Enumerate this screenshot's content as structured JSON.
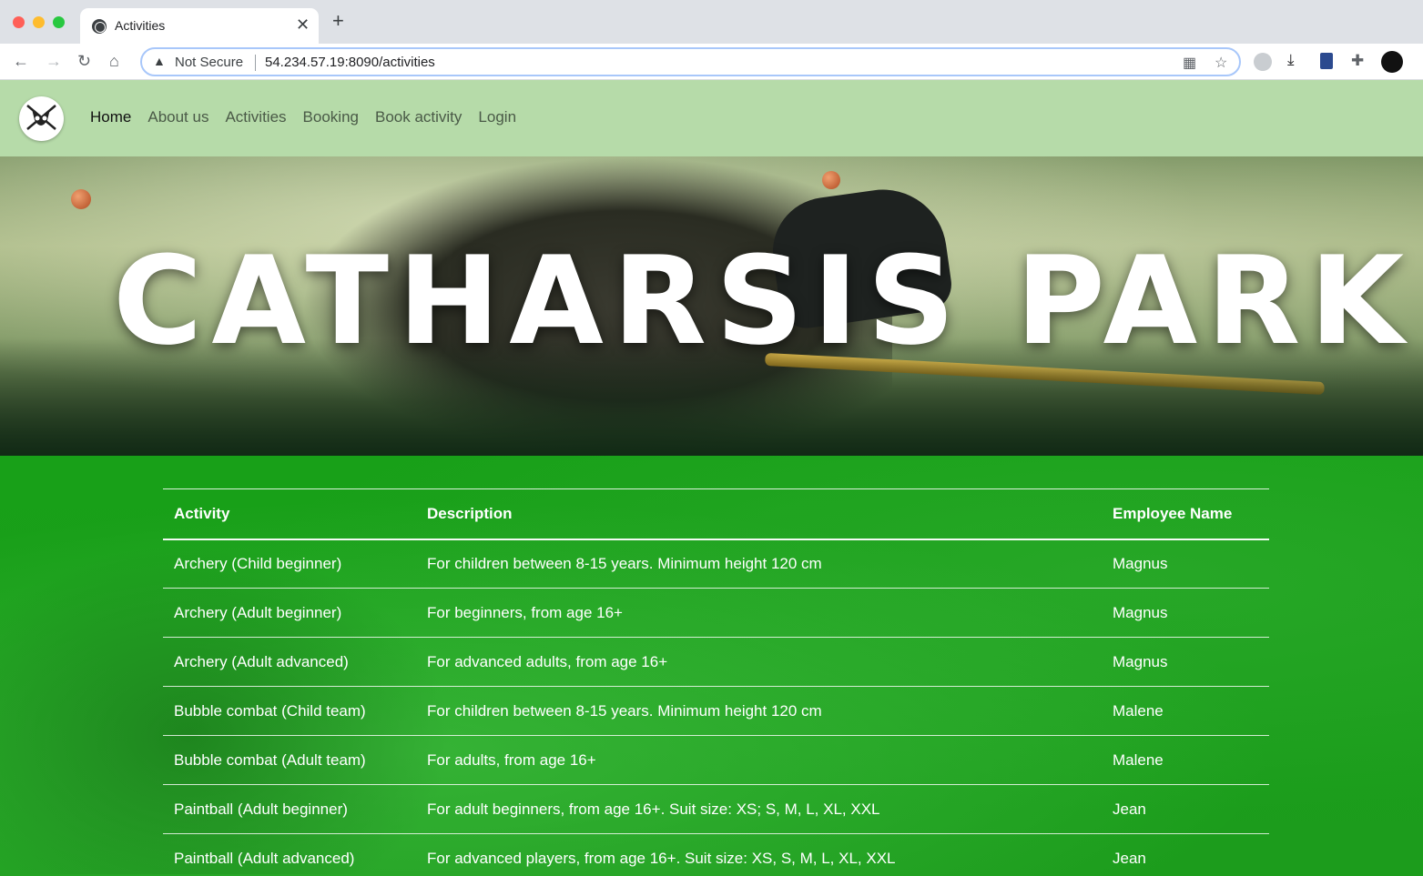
{
  "browser": {
    "tab_title": "Activities",
    "not_secure_label": "Not Secure",
    "url": "54.234.57.19:8090/activities"
  },
  "site": {
    "nav": [
      {
        "label": "Home",
        "active": true
      },
      {
        "label": "About us",
        "active": false
      },
      {
        "label": "Activities",
        "active": false
      },
      {
        "label": "Booking",
        "active": false
      },
      {
        "label": "Book activity",
        "active": false
      },
      {
        "label": "Login",
        "active": false
      }
    ],
    "hero_title": "CATHARSIS PARK"
  },
  "table": {
    "headers": [
      "Activity",
      "Description",
      "Employee Name"
    ],
    "rows": [
      {
        "activity": "Archery (Child beginner)",
        "description": "For children between 8-15 years. Minimum height 120 cm",
        "employee": "Magnus"
      },
      {
        "activity": "Archery (Adult beginner)",
        "description": "For beginners, from age 16+",
        "employee": "Magnus"
      },
      {
        "activity": "Archery (Adult advanced)",
        "description": "For advanced adults, from age 16+",
        "employee": "Magnus"
      },
      {
        "activity": "Bubble combat (Child team)",
        "description": "For children between 8-15 years. Minimum height 120 cm",
        "employee": "Malene"
      },
      {
        "activity": "Bubble combat (Adult team)",
        "description": "For adults, from age 16+",
        "employee": "Malene"
      },
      {
        "activity": "Paintball (Adult beginner)",
        "description": "For adult beginners, from age 16+. Suit size: XS; S, M, L, XL, XXL",
        "employee": "Jean"
      },
      {
        "activity": "Paintball (Adult advanced)",
        "description": "For advanced players, from age 16+. Suit size: XS, S, M, L, XL, XXL",
        "employee": "Jean"
      }
    ]
  }
}
